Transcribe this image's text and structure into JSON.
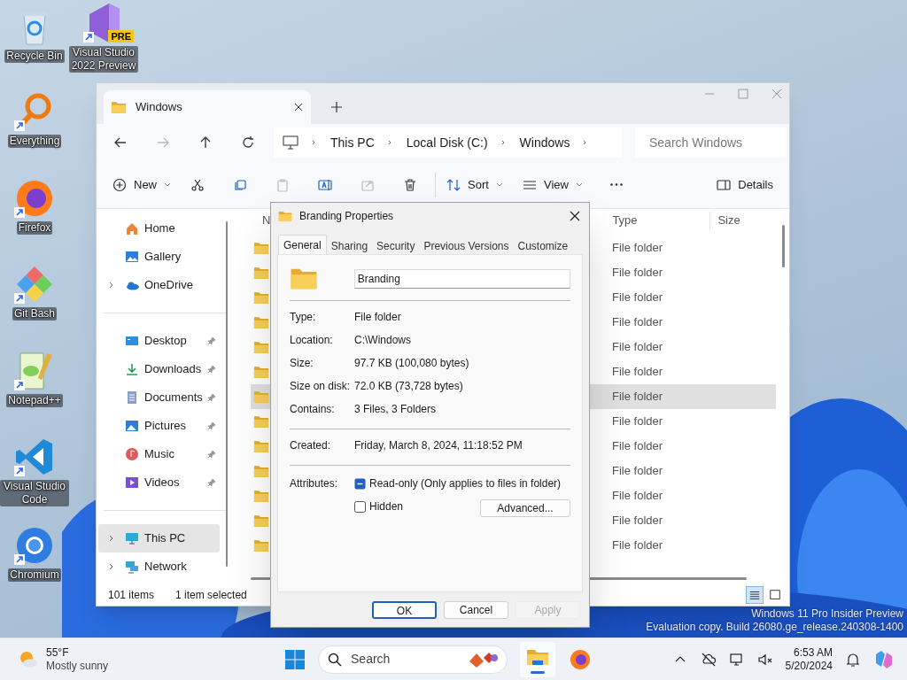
{
  "desktop_icons": [
    {
      "label": "Recycle Bin",
      "kind": "recycle"
    },
    {
      "label": "Visual Studio 2022 Preview",
      "kind": "vs",
      "badge": "PRE"
    },
    {
      "label": "Everything",
      "kind": "everything"
    },
    {
      "label": "Firefox",
      "kind": "firefox"
    },
    {
      "label": "Git Bash",
      "kind": "gitbash"
    },
    {
      "label": "Notepad++",
      "kind": "notepad"
    },
    {
      "label": "Visual Studio Code",
      "kind": "vscode"
    },
    {
      "label": "Chromium",
      "kind": "chromium"
    }
  ],
  "explorer": {
    "tab": {
      "title": "Windows"
    },
    "breadcrumb": [
      "This PC",
      "Local Disk (C:)",
      "Windows"
    ],
    "search": {
      "placeholder": "Search Windows"
    },
    "toolbar": [
      {
        "kind": "new",
        "label": "New",
        "disabled": false
      },
      {
        "kind": "cut",
        "disabled": false
      },
      {
        "kind": "copy",
        "disabled": false
      },
      {
        "kind": "paste",
        "disabled": true
      },
      {
        "kind": "rename",
        "disabled": false
      },
      {
        "kind": "share",
        "disabled": true
      },
      {
        "kind": "delete",
        "disabled": false
      },
      {
        "kind": "sort",
        "label": "Sort",
        "disabled": false
      },
      {
        "kind": "view",
        "label": "View",
        "disabled": false
      },
      {
        "kind": "more",
        "disabled": false
      }
    ],
    "details_button": "Details",
    "sidebar": {
      "groups": [
        [
          {
            "label": "Home",
            "kind": "home",
            "expandable": false,
            "pinned": false,
            "selected": false
          },
          {
            "label": "Gallery",
            "kind": "gallery",
            "expandable": false,
            "pinned": false,
            "selected": false
          },
          {
            "label": "OneDrive",
            "kind": "onedrive",
            "expandable": true,
            "pinned": false,
            "selected": false
          }
        ],
        [
          {
            "label": "Desktop",
            "kind": "desktop",
            "expandable": false,
            "pinned": true,
            "selected": false
          },
          {
            "label": "Downloads",
            "kind": "downloads",
            "expandable": false,
            "pinned": true,
            "selected": false
          },
          {
            "label": "Documents",
            "kind": "documents",
            "expandable": false,
            "pinned": true,
            "selected": false
          },
          {
            "label": "Pictures",
            "kind": "pictures",
            "expandable": false,
            "pinned": true,
            "selected": false
          },
          {
            "label": "Music",
            "kind": "music",
            "expandable": false,
            "pinned": true,
            "selected": false
          },
          {
            "label": "Videos",
            "kind": "videos",
            "expandable": false,
            "pinned": true,
            "selected": false
          }
        ],
        [
          {
            "label": "This PC",
            "kind": "thispc",
            "expandable": true,
            "pinned": false,
            "selected": true
          },
          {
            "label": "Network",
            "kind": "network",
            "expandable": true,
            "pinned": false,
            "selected": false
          }
        ]
      ]
    },
    "file_list": {
      "columns": [
        "N",
        "Type",
        "Size"
      ],
      "rows": [
        {
          "type": "File folder",
          "selected": false
        },
        {
          "type": "File folder",
          "selected": false
        },
        {
          "type": "File folder",
          "selected": false
        },
        {
          "type": "File folder",
          "selected": false
        },
        {
          "type": "File folder",
          "selected": false
        },
        {
          "type": "File folder",
          "selected": false
        },
        {
          "type": "File folder",
          "selected": true
        },
        {
          "type": "File folder",
          "selected": false
        },
        {
          "type": "File folder",
          "selected": false
        },
        {
          "type": "File folder",
          "selected": false
        },
        {
          "type": "File folder",
          "selected": false
        },
        {
          "type": "File folder",
          "selected": false
        },
        {
          "type": "File folder",
          "selected": false
        }
      ]
    },
    "status_bar": {
      "item_count": "101 items",
      "selection": "1 item selected",
      "views": [
        {
          "kind": "details",
          "selected": true
        },
        {
          "kind": "tiles",
          "selected": false
        }
      ]
    }
  },
  "dialog": {
    "title": "Branding Properties",
    "tabs": [
      {
        "label": "General",
        "selected": true
      },
      {
        "label": "Sharing",
        "selected": false
      },
      {
        "label": "Security",
        "selected": false
      },
      {
        "label": "Previous Versions",
        "selected": false
      },
      {
        "label": "Customize",
        "selected": false
      }
    ],
    "name_field": "Branding",
    "property_groups": [
      [
        {
          "label": "Type:",
          "value": "File folder"
        },
        {
          "label": "Location:",
          "value": "C:\\Windows"
        },
        {
          "label": "Size:",
          "value": "97.7 KB (100,080 bytes)"
        },
        {
          "label": "Size on disk:",
          "value": "72.0 KB (73,728 bytes)"
        },
        {
          "label": "Contains:",
          "value": "3 Files, 3 Folders"
        }
      ],
      [
        {
          "label": "Created:",
          "value": "Friday, March 8, 2024, 11:18:52 PM"
        }
      ]
    ],
    "attributes": {
      "label": "Attributes:",
      "options": [
        {
          "label": "Read-only (Only applies to files in folder)",
          "checked": true,
          "indeterminate": true
        },
        {
          "label": "Hidden",
          "checked": false,
          "indeterminate": false
        }
      ],
      "advanced_button": "Advanced..."
    },
    "buttons": [
      {
        "label": "OK",
        "default": true,
        "disabled": false
      },
      {
        "label": "Cancel",
        "default": false,
        "disabled": false
      },
      {
        "label": "Apply",
        "default": false,
        "disabled": true
      }
    ]
  },
  "watermark": [
    "Windows 11 Pro Insider Preview",
    "Evaluation copy. Build 26080.ge_release.240308-1400"
  ],
  "taskbar": {
    "weather": {
      "temperature": "55°F",
      "condition": "Mostly sunny"
    },
    "search": {
      "placeholder": "Search"
    },
    "apps": [
      {
        "kind": "explorer",
        "active": true
      },
      {
        "kind": "firefox",
        "active": false
      }
    ],
    "time": "6:53 AM",
    "date": "5/20/2024"
  }
}
